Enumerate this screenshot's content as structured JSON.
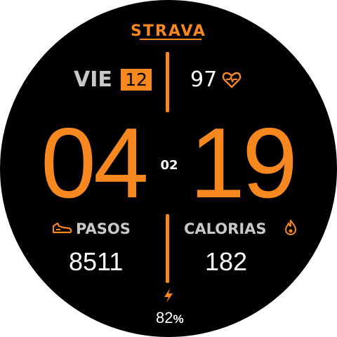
{
  "app": {
    "brand": "STRAVA"
  },
  "date": {
    "weekday": "VIE",
    "day": "12"
  },
  "heart_rate": {
    "value": "97",
    "icon": "heart-rate-icon"
  },
  "time": {
    "hours": "04",
    "minutes": "19",
    "seconds": "02"
  },
  "steps": {
    "label": "PASOS",
    "value": "8511",
    "icon": "shoe-icon"
  },
  "calories": {
    "label": "CALORIAS",
    "value": "182",
    "icon": "flame-icon"
  },
  "battery": {
    "value": "82",
    "unit": "%",
    "icon": "bolt-icon"
  },
  "colors": {
    "accent": "#f7871f",
    "background": "#000000",
    "text": "#ffffff",
    "label": "#c8c8c8"
  }
}
